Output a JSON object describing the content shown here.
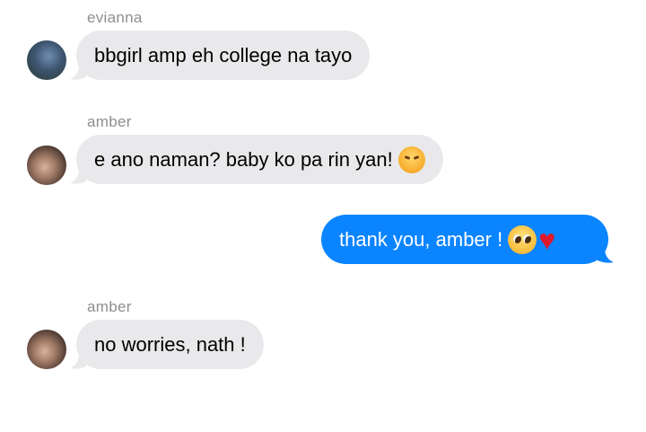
{
  "messages": [
    {
      "sender": "evianna",
      "text": "bbgirl amp eh college na tayo",
      "direction": "incoming",
      "avatar": "evianna-avatar"
    },
    {
      "sender": "amber",
      "text": "e ano naman? baby ko pa rin yan!",
      "emoji": "angry-face-icon",
      "direction": "incoming",
      "avatar": "amber-avatar"
    },
    {
      "sender": "",
      "text": "thank you, amber !",
      "emoji": [
        "pleading-face-icon",
        "red-heart-icon"
      ],
      "direction": "outgoing"
    },
    {
      "sender": "amber",
      "text": "no worries, nath !",
      "direction": "incoming",
      "avatar": "amber-avatar"
    }
  ],
  "colors": {
    "incoming_bubble": "#e9e9eb",
    "outgoing_bubble": "#0b84ff",
    "sender_name": "#8e8e93"
  }
}
